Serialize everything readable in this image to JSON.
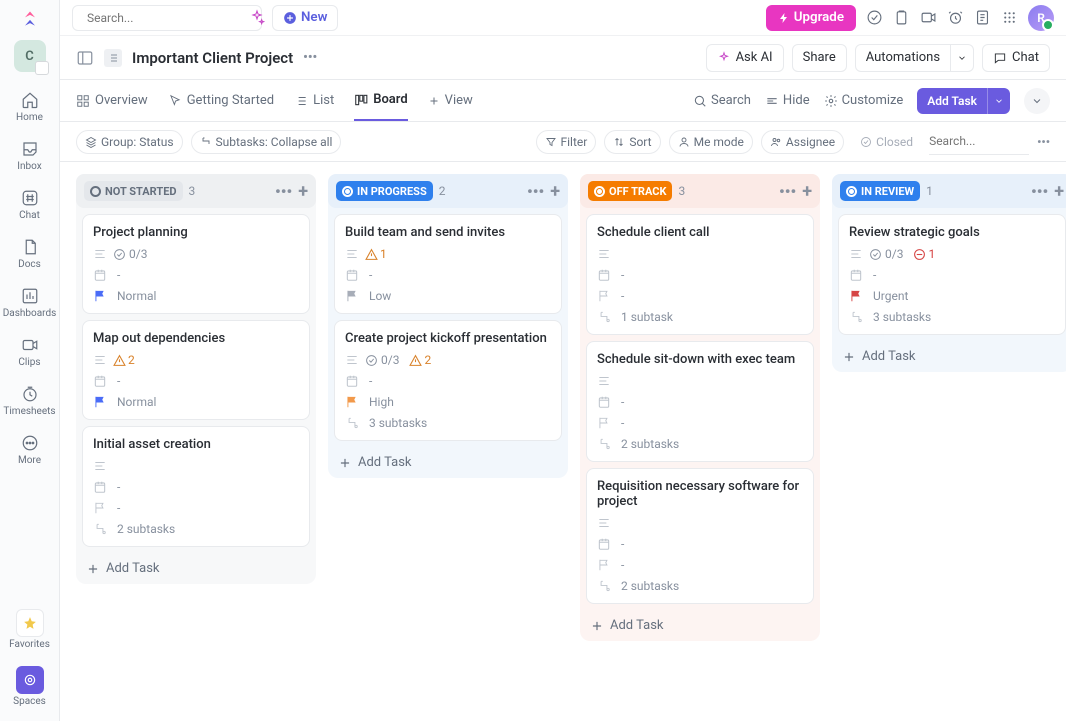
{
  "topbar": {
    "search_placeholder": "Search...",
    "new_label": "New",
    "upgrade_label": "Upgrade",
    "avatar_initial": "R"
  },
  "sidebar": {
    "workspace_initial": "C",
    "items": [
      {
        "label": "Home"
      },
      {
        "label": "Inbox"
      },
      {
        "label": "Chat"
      },
      {
        "label": "Docs"
      },
      {
        "label": "Dashboards"
      },
      {
        "label": "Clips"
      },
      {
        "label": "Timesheets"
      },
      {
        "label": "More"
      }
    ],
    "favorites_label": "Favorites",
    "spaces_label": "Spaces"
  },
  "header": {
    "title": "Important Client Project",
    "ask_ai": "Ask AI",
    "share": "Share",
    "automations": "Automations",
    "chat": "Chat"
  },
  "tabs": {
    "overview": "Overview",
    "getting_started": "Getting Started",
    "list": "List",
    "board": "Board",
    "view": "View",
    "search": "Search",
    "hide": "Hide",
    "customize": "Customize",
    "add_task": "Add Task"
  },
  "toolbar": {
    "group": "Group: Status",
    "subtasks": "Subtasks: Collapse all",
    "filter": "Filter",
    "sort": "Sort",
    "me_mode": "Me mode",
    "assignee": "Assignee",
    "closed": "Closed",
    "search_placeholder": "Search..."
  },
  "board": {
    "add_task_label": "Add Task",
    "columns": [
      {
        "id": "not_started",
        "label": "NOT STARTED",
        "count": "3",
        "cards": [
          {
            "title": "Project planning",
            "check": "0/3",
            "date": "-",
            "priority": "Normal",
            "priority_style": "blue"
          },
          {
            "title": "Map out dependencies",
            "warn": "2",
            "date": "-",
            "priority": "Normal",
            "priority_style": "blue"
          },
          {
            "title": "Initial asset creation",
            "date": "-",
            "flag": "-",
            "subtasks": "2 subtasks"
          }
        ]
      },
      {
        "id": "in_progress",
        "label": "IN PROGRESS",
        "count": "2",
        "cards": [
          {
            "title": "Build team and send invites",
            "warn": "1",
            "date": "-",
            "priority": "Low",
            "priority_style": "grey"
          },
          {
            "title": "Create project kickoff presentation",
            "check": "0/3",
            "warn": "2",
            "date": "-",
            "priority": "High",
            "priority_style": "orange",
            "subtasks": "3 subtasks"
          }
        ]
      },
      {
        "id": "off_track",
        "label": "OFF TRACK",
        "count": "3",
        "cards": [
          {
            "title": "Schedule client call",
            "desc_only": true,
            "date": "-",
            "flag": "-",
            "subtasks": "1 subtask"
          },
          {
            "title": "Schedule sit-down with exec team",
            "desc_only": true,
            "date": "-",
            "flag": "-",
            "subtasks": "2 subtasks"
          },
          {
            "title": "Requisition necessary software for project",
            "desc_only": true,
            "date": "-",
            "flag": "-",
            "subtasks": "2 subtasks"
          }
        ]
      },
      {
        "id": "in_review",
        "label": "IN REVIEW",
        "count": "1",
        "cards": [
          {
            "title": "Review strategic goals",
            "check": "0/3",
            "block": "1",
            "date": "-",
            "priority": "Urgent",
            "priority_style": "red",
            "subtasks": "3 subtasks"
          }
        ]
      }
    ]
  }
}
